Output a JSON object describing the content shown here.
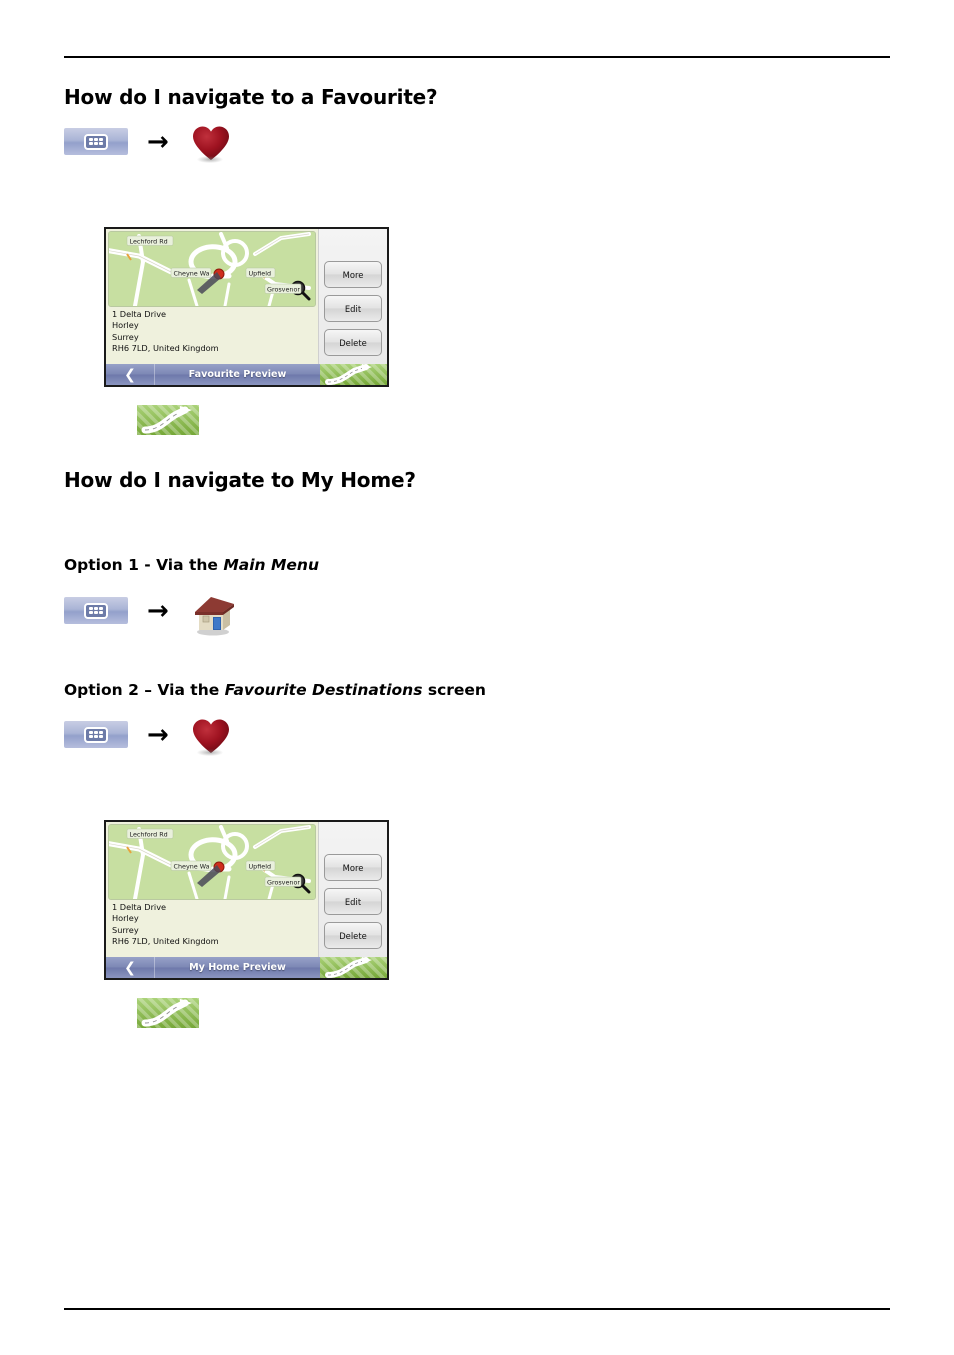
{
  "document": {
    "sections": [
      {
        "id": "favourite",
        "heading": "How do I navigate to a Favourite?",
        "steps": {
          "menu_icon": "main-menu-grid-icon",
          "arrow": "→",
          "target_icon": "heart-icon"
        }
      },
      {
        "id": "my-home",
        "heading": "How do I navigate to My Home?",
        "option1": {
          "prefix": "Option 1 - Via the ",
          "emphasis": "Main Menu",
          "suffix": "",
          "menu_icon": "main-menu-grid-icon",
          "arrow": "→",
          "target_icon": "house-icon"
        },
        "option2": {
          "prefix": "Option 2 – Via the ",
          "emphasis": "Favourite Destinations",
          "suffix": " screen",
          "menu_icon": "main-menu-grid-icon",
          "arrow": "→",
          "target_icon": "heart-icon"
        }
      }
    ]
  },
  "device_favourite": {
    "title": "Favourite Preview",
    "back_glyph": "❮",
    "address": {
      "line1": "1 Delta Drive",
      "line2": "Horley",
      "line3": "Surrey",
      "line4": "RH6 7LD, United Kingdom"
    },
    "buttons": {
      "more": "More",
      "edit": "Edit",
      "delete": "Delete"
    },
    "map": {
      "labels": [
        "Lechford Rd",
        "Cheyne Wa",
        "Upfield",
        "Grosvenor"
      ],
      "marker": "destination-pin",
      "background_color": "#c7dfa1",
      "road_color": "#ffffff"
    },
    "go_button": "drive-to-icon"
  },
  "device_my_home": {
    "title": "My Home Preview",
    "back_glyph": "❮",
    "address": {
      "line1": "1 Delta Drive",
      "line2": "Horley",
      "line3": "Surrey",
      "line4": "RH6 7LD, United Kingdom"
    },
    "buttons": {
      "more": "More",
      "edit": "Edit",
      "delete": "Delete"
    },
    "map": {
      "labels": [
        "Lechford Rd",
        "Cheyne Wa",
        "Upfield",
        "Grosvenor"
      ],
      "marker": "destination-pin",
      "background_color": "#c7dfa1",
      "road_color": "#ffffff"
    },
    "go_button": "drive-to-icon"
  },
  "colors": {
    "rule": "#000000",
    "menu_button": "#9aa5cf",
    "heart": "#9e1220",
    "house_roof": "#8d3a33",
    "title_bar": "#7d88b5",
    "go_green": "#86bf3f",
    "map_green": "#c7dfa1",
    "panel_cream": "#eff1dd"
  }
}
